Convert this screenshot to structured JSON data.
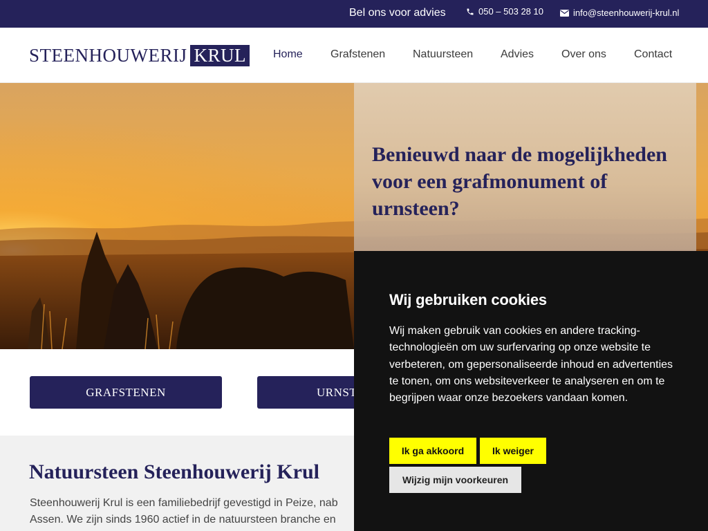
{
  "topbar": {
    "advice_label": "Bel ons voor advies",
    "phone": "050 – 503 28 10",
    "email": "info@steenhouwerij-krul.nl",
    "phone_icon": "phone-icon",
    "email_icon": "envelope-icon"
  },
  "header": {
    "logo_part1": "STEENHOUWERIJ",
    "logo_part2": "KRUL",
    "nav": [
      {
        "label": "Home",
        "active": true
      },
      {
        "label": "Grafstenen"
      },
      {
        "label": "Natuursteen"
      },
      {
        "label": "Advies"
      },
      {
        "label": "Over ons"
      },
      {
        "label": "Contact"
      }
    ]
  },
  "hero": {
    "heading": "Benieuwd naar de mogelijkheden voor een grafmonument of urnsteen?"
  },
  "categories": [
    {
      "label": "GRAFSTENEN"
    },
    {
      "label": "URNST"
    }
  ],
  "intro": {
    "title": "Natuursteen Steenhouwerij Krul",
    "line1": "Steenhouwerij Krul is een familiebedrijf gevestigd in Peize, nab",
    "line2": "Assen. We zijn sinds 1960 actief in de natuursteen branche en"
  },
  "cookie": {
    "title": "Wij gebruiken cookies",
    "text": "Wij maken gebruik van cookies en andere tracking-technologieën om uw surfervaring op onze website te verbeteren, om gepersonaliseerde inhoud en advertenties te tonen, om ons websiteverkeer te analyseren en om te begrijpen waar onze bezoekers vandaan komen.",
    "accept": "Ik ga akkoord",
    "decline": "Ik weiger",
    "preferences": "Wijzig mijn voorkeuren"
  },
  "colors": {
    "brand": "#25225a",
    "cookie_bg": "#121212",
    "cookie_accept": "#ffff00"
  }
}
